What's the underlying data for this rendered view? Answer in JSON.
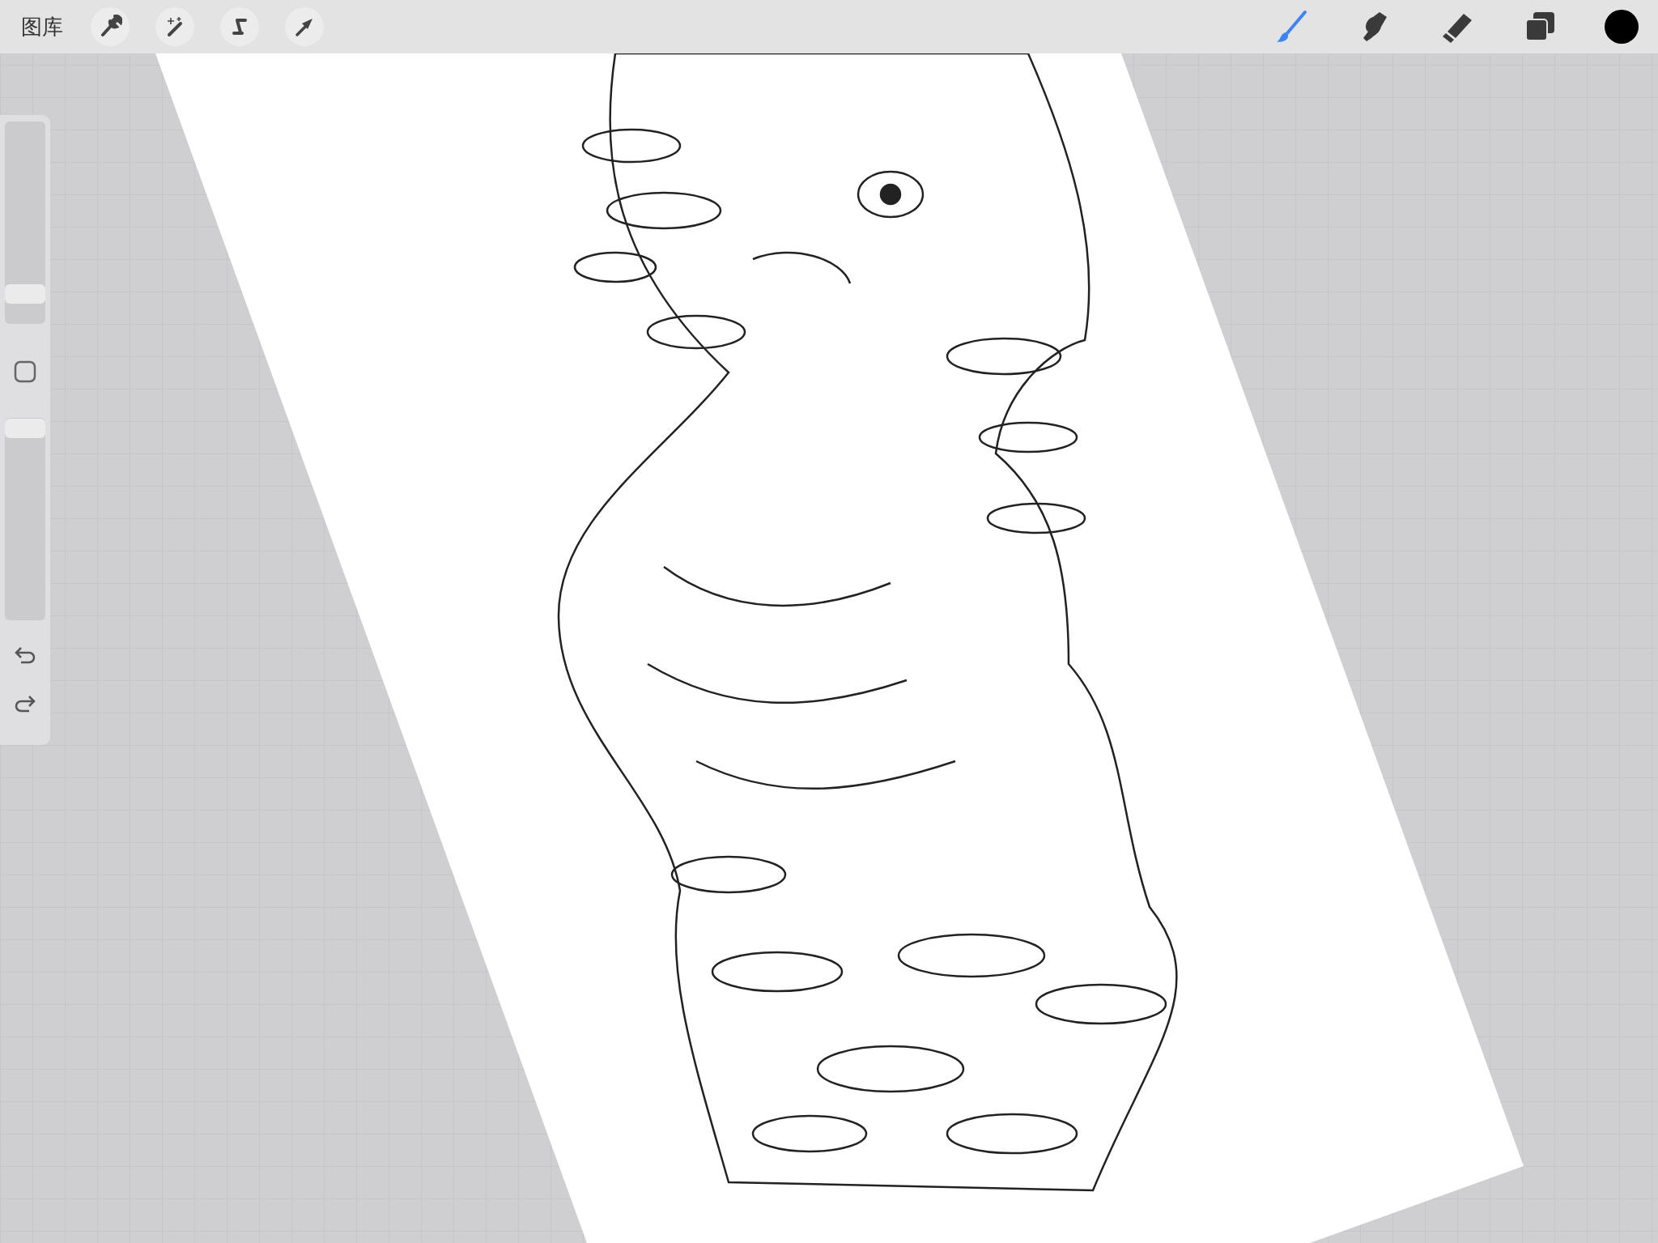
{
  "toolbar": {
    "gallery_label": "图库",
    "left_tools": [
      {
        "kind": "wrench"
      },
      {
        "kind": "wand"
      },
      {
        "kind": "selection"
      },
      {
        "kind": "transform"
      }
    ],
    "right_tools": [
      {
        "kind": "brush",
        "selected": true
      },
      {
        "kind": "smudge",
        "selected": false
      },
      {
        "kind": "eraser",
        "selected": false
      },
      {
        "kind": "layers",
        "selected": false
      }
    ],
    "color": "#000000"
  },
  "sidebar": {
    "brush_size": {
      "level": 0.15
    },
    "opacity": {
      "level": 0.95
    }
  }
}
